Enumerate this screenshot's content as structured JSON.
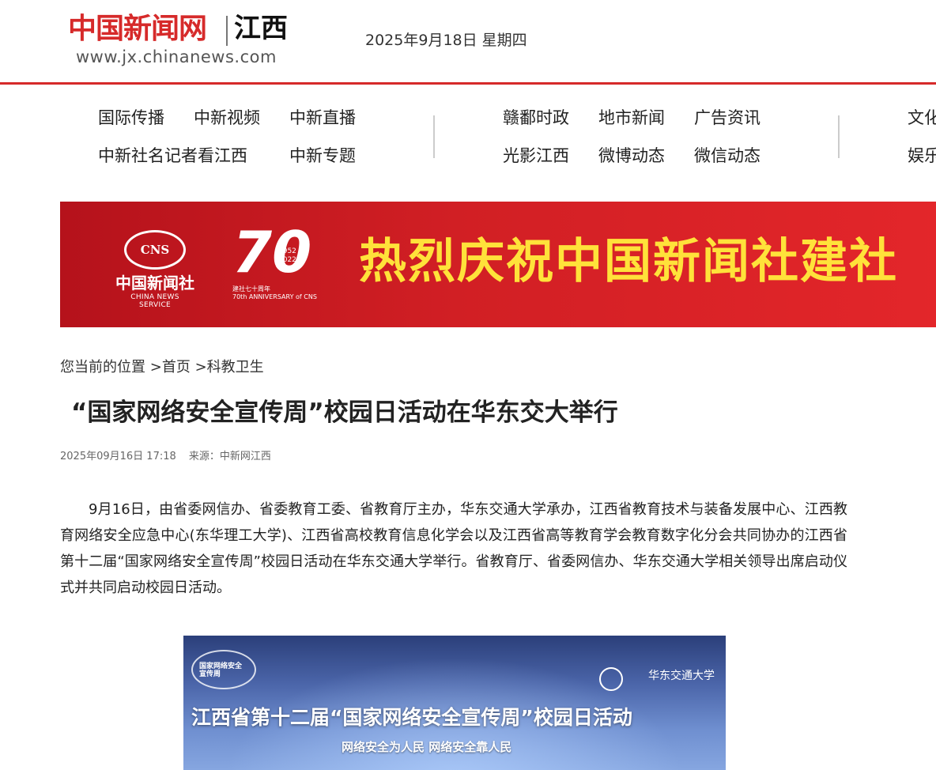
{
  "header": {
    "logo_cn": "中国新闻网",
    "logo_region": "江西",
    "logo_url": "www.jx.chinanews.com",
    "date": "2025年9月18日 星期四"
  },
  "nav": {
    "group1": {
      "row1": [
        "国际传播",
        "中新视频",
        "中新直播"
      ],
      "row2": [
        "中新社名记者看江西",
        "中新专题"
      ]
    },
    "group2": {
      "row1": [
        "赣鄱时政",
        "地市新闻",
        "广告资讯"
      ],
      "row2": [
        "光影江西",
        "微博动态",
        "微信动态"
      ]
    },
    "group3": {
      "row1": [
        "文化"
      ],
      "row2": [
        "娱乐"
      ]
    }
  },
  "banner": {
    "cns_emblem": "CNS",
    "cns_name_cn": "中国新闻社",
    "cns_name_en": "CHINA NEWS SERVICE",
    "anniv_number": "70",
    "anniv_years": "1952\n2022",
    "anniv_sub_cn": "建社七十周年",
    "anniv_sub_en": "70th ANNIVERSARY of CNS",
    "title": "热烈庆祝中国新闻社建社"
  },
  "breadcrumb": {
    "prefix": "您当前的位置",
    "items": [
      ">首页",
      ">科教卫生"
    ]
  },
  "article": {
    "title": "“国家网络安全宣传周”校园日活动在华东交大举行",
    "datetime": "2025年09月16日 17:18",
    "source": "来源：中新网江西",
    "body": "9月16日，由省委网信办、省委教育工委、省教育厅主办，华东交通大学承办，江西省教育技术与装备发展中心、江西教育网络安全应急中心(东华理工大学)、江西省高校教育信息化学会以及江西省高等教育学会教育数字化分会共同协办的江西省第十二届“国家网络安全宣传周”校园日活动在华东交通大学举行。省教育厅、省委网信办、华东交通大学相关领导出席启动仪式并共同启动校园日活动。"
  },
  "photo": {
    "logo_text": "国家网络安全\n宣传周",
    "university": "华东交通大学",
    "headline": "江西省第十二届“国家网络安全宣传周”校园日活动",
    "slogan": "网络安全为人民  网络安全靠人民"
  }
}
